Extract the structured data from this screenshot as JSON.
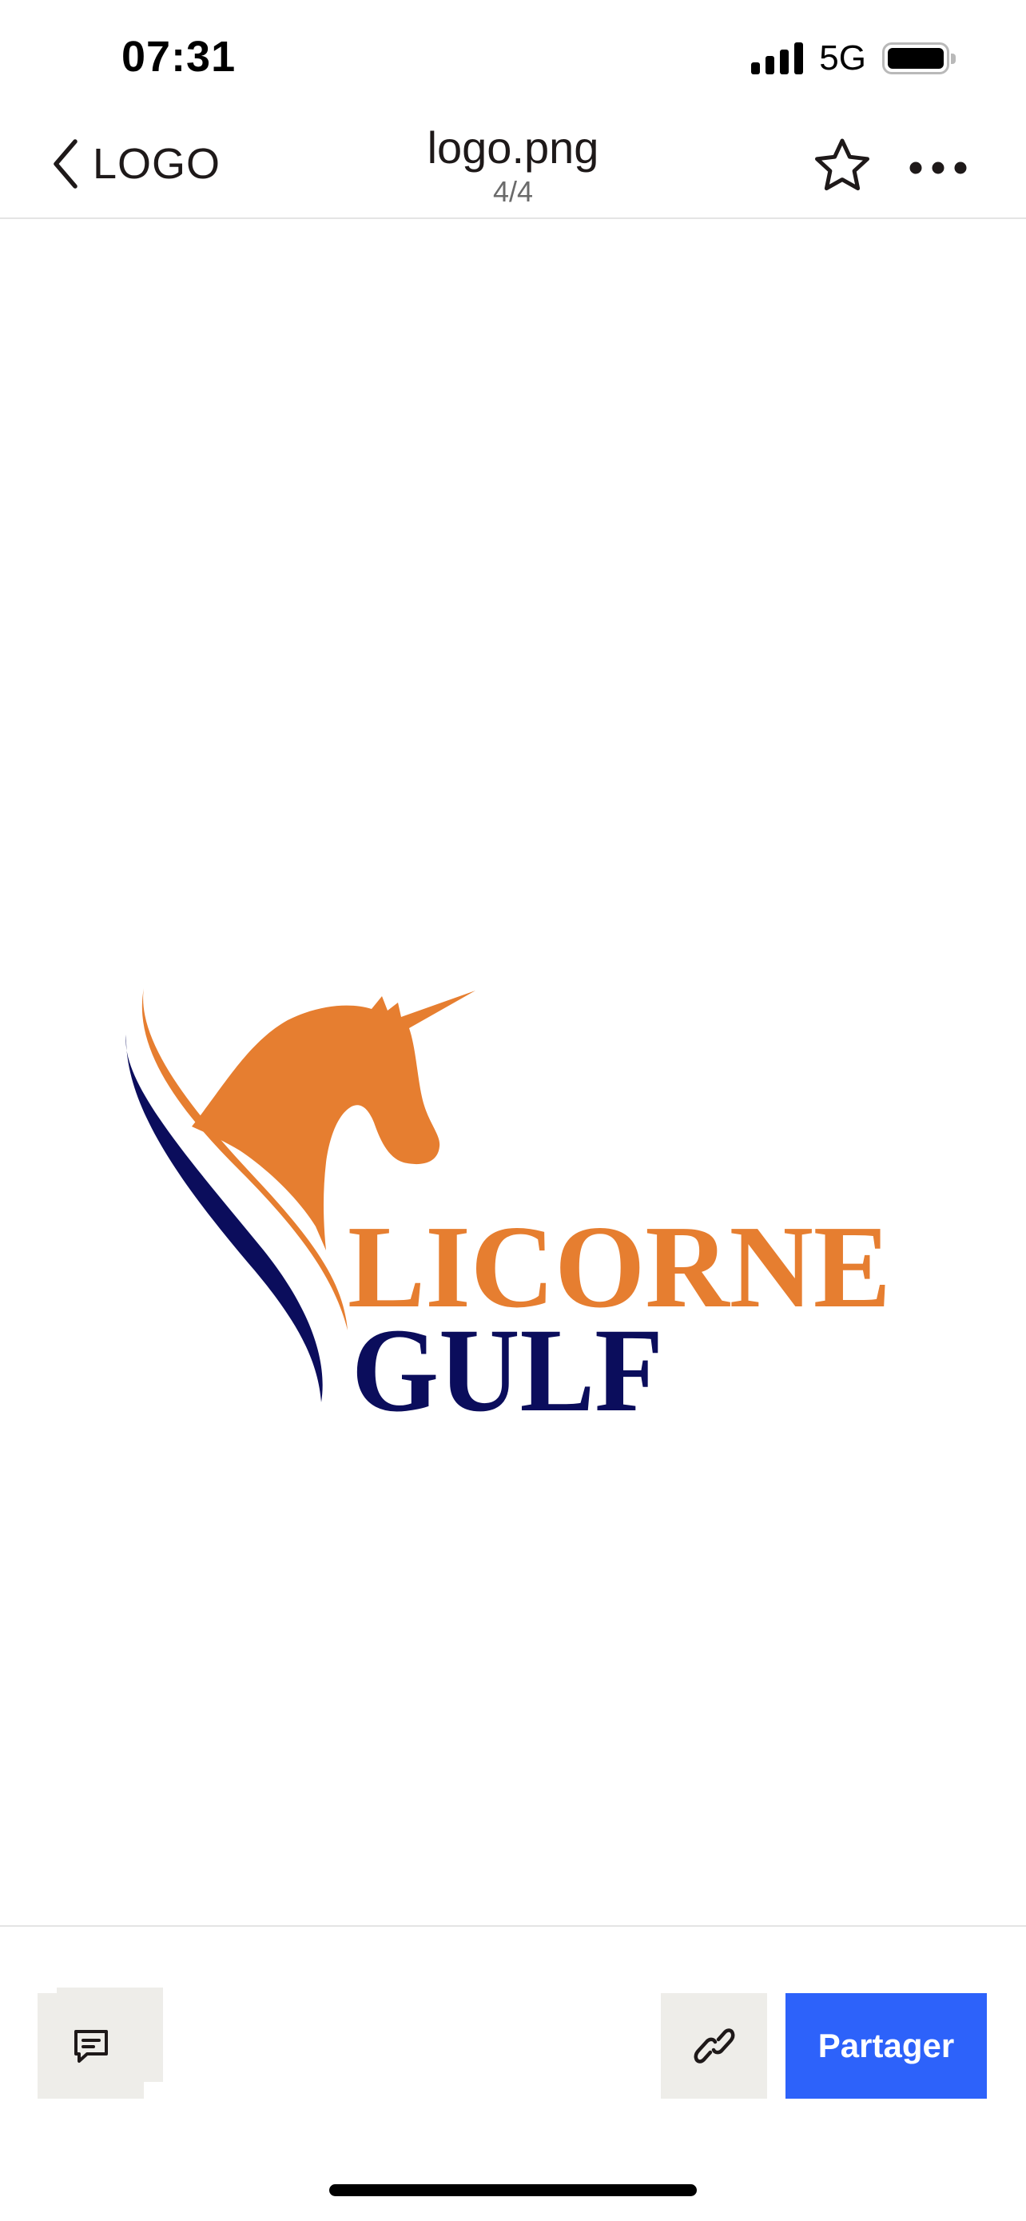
{
  "status_bar": {
    "time": "07:31",
    "network": "5G",
    "signal_bars": 4,
    "battery_level": 1.0
  },
  "nav": {
    "back_label": "LOGO",
    "filename": "logo.png",
    "pager": "4/4",
    "icons": {
      "back": "chevron-left-icon",
      "favorite": "star-icon",
      "more": "more-horizontal-icon"
    }
  },
  "preview": {
    "logo_text_line1": "LICORNE",
    "logo_text_line2": "GULF",
    "colors": {
      "orange": "#E67E30",
      "navy": "#0B0D5C"
    },
    "info_icon": "info-icon"
  },
  "toolbar": {
    "comment_icon": "comment-icon",
    "link_icon": "link-icon",
    "share_label": "Partager",
    "share_color": "#2D62FA"
  }
}
